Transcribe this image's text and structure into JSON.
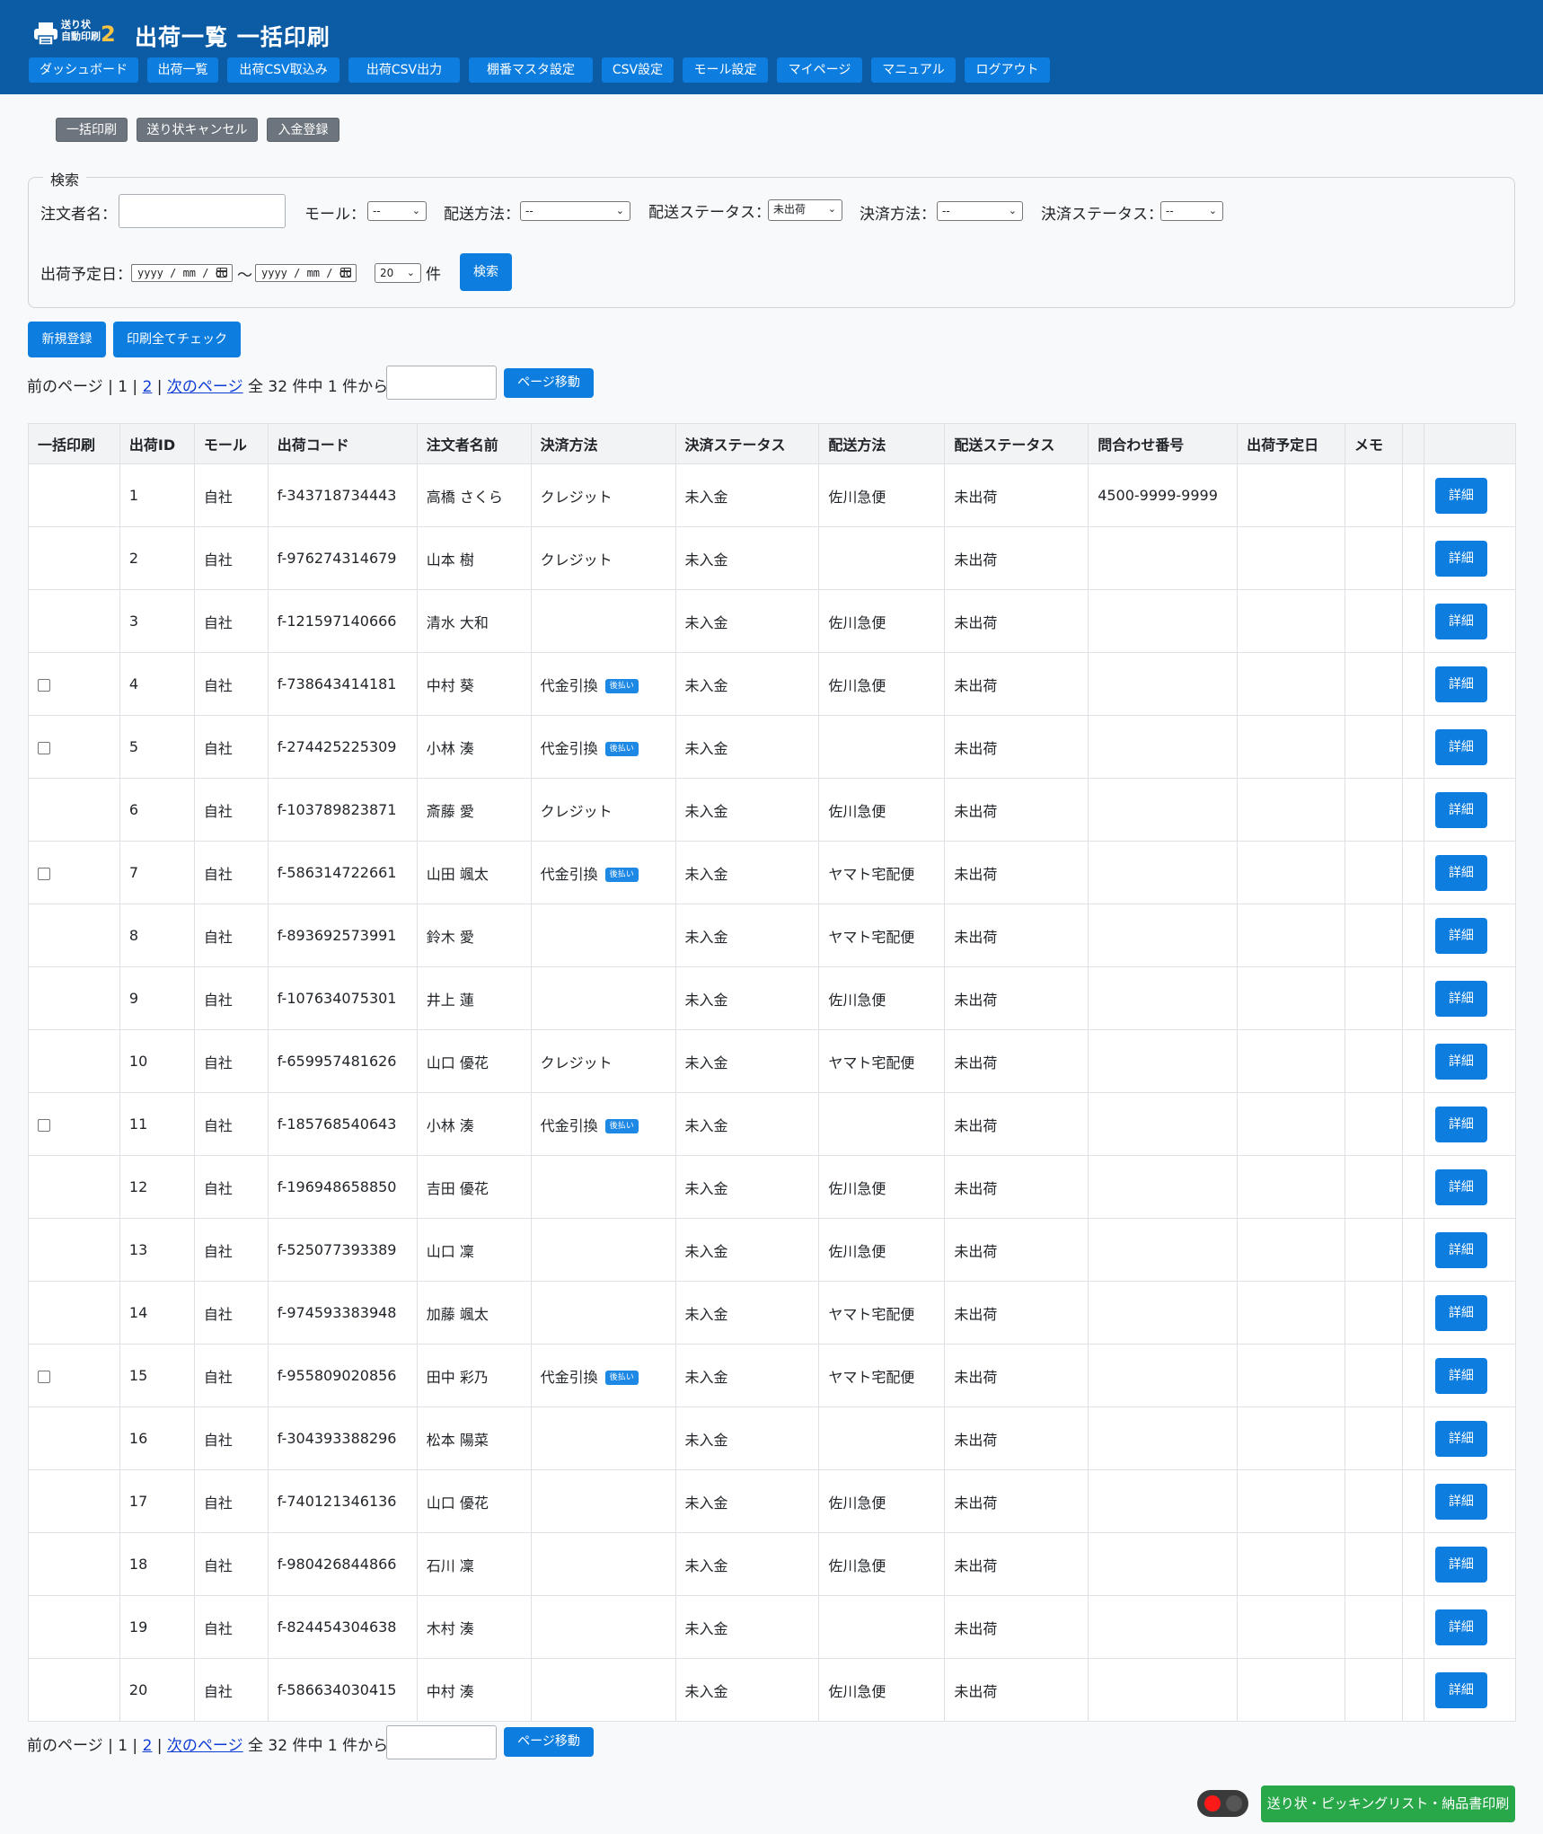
{
  "header": {
    "logo_line1": "送り状",
    "logo_line2": "自動印刷",
    "logo_num": "2",
    "title": "出荷一覧 一括印刷"
  },
  "nav": [
    "ダッシュボード",
    "出荷一覧",
    "出荷CSV取込み",
    "出荷CSV出力",
    "棚番マスタ設定",
    "CSV設定",
    "モール設定",
    "マイページ",
    "マニュアル",
    "ログアウト"
  ],
  "actions": [
    "一括印刷",
    "送り状キャンセル",
    "入金登録"
  ],
  "search": {
    "legend": "検索",
    "orderer_label": "注文者名：",
    "orderer_value": "",
    "mall_label": "モール：",
    "mall_value": "--",
    "ship_method_label": "配送方法：",
    "ship_method_value": "--",
    "ship_status_label": "配送ステータス：",
    "ship_status_value": "未出荷",
    "pay_method_label": "決済方法：",
    "pay_method_value": "--",
    "pay_status_label": "決済ステータス：",
    "pay_status_value": "--",
    "date_label": "出荷予定日：",
    "date_from": "yyyy / mm / dd",
    "date_sep": "〜",
    "date_to": "yyyy / mm / dd",
    "per_page": "20",
    "per_page_unit": "件",
    "search_button": "検索"
  },
  "buttons": {
    "new": "新規登録",
    "check_all": "印刷全てチェック",
    "page_move": "ページ移動",
    "detail": "詳細",
    "bottom_print": "送り状・ピッキングリスト・納品書印刷"
  },
  "pager": {
    "prev": "前のページ",
    "sep1": " | 1 | ",
    "page2": "2",
    "sep2": " | ",
    "next": "次のページ",
    "summary": " 全 32 件中 1 件から表示"
  },
  "table": {
    "headers": [
      "一括印刷",
      "出荷ID",
      "モール",
      "出荷コード",
      "注文者名前",
      "決済方法",
      "決済ステータス",
      "配送方法",
      "配送ステータス",
      "問合わせ番号",
      "出荷予定日",
      "メモ",
      "",
      ""
    ],
    "badge": "後払い",
    "rows": [
      {
        "check": false,
        "id": "1",
        "mall": "自社",
        "code": "f-343718734443",
        "name": "高橋 さくら",
        "pay": "クレジット",
        "badge": false,
        "pay_status": "未入金",
        "ship": "佐川急便",
        "ship_status": "未出荷",
        "tracking": "4500-9999-9999"
      },
      {
        "check": false,
        "id": "2",
        "mall": "自社",
        "code": "f-976274314679",
        "name": "山本 樹",
        "pay": "クレジット",
        "badge": false,
        "pay_status": "未入金",
        "ship": "",
        "ship_status": "未出荷",
        "tracking": ""
      },
      {
        "check": false,
        "id": "3",
        "mall": "自社",
        "code": "f-121597140666",
        "name": "清水 大和",
        "pay": "",
        "badge": false,
        "pay_status": "未入金",
        "ship": "佐川急便",
        "ship_status": "未出荷",
        "tracking": ""
      },
      {
        "check": true,
        "id": "4",
        "mall": "自社",
        "code": "f-738643414181",
        "name": "中村 葵",
        "pay": "代金引換",
        "badge": true,
        "pay_status": "未入金",
        "ship": "佐川急便",
        "ship_status": "未出荷",
        "tracking": ""
      },
      {
        "check": true,
        "id": "5",
        "mall": "自社",
        "code": "f-274425225309",
        "name": "小林 湊",
        "pay": "代金引換",
        "badge": true,
        "pay_status": "未入金",
        "ship": "",
        "ship_status": "未出荷",
        "tracking": ""
      },
      {
        "check": false,
        "id": "6",
        "mall": "自社",
        "code": "f-103789823871",
        "name": "斎藤 愛",
        "pay": "クレジット",
        "badge": false,
        "pay_status": "未入金",
        "ship": "佐川急便",
        "ship_status": "未出荷",
        "tracking": ""
      },
      {
        "check": true,
        "id": "7",
        "mall": "自社",
        "code": "f-586314722661",
        "name": "山田 颯太",
        "pay": "代金引換",
        "badge": true,
        "pay_status": "未入金",
        "ship": "ヤマト宅配便",
        "ship_status": "未出荷",
        "tracking": ""
      },
      {
        "check": false,
        "id": "8",
        "mall": "自社",
        "code": "f-893692573991",
        "name": "鈴木 愛",
        "pay": "",
        "badge": false,
        "pay_status": "未入金",
        "ship": "ヤマト宅配便",
        "ship_status": "未出荷",
        "tracking": ""
      },
      {
        "check": false,
        "id": "9",
        "mall": "自社",
        "code": "f-107634075301",
        "name": "井上 蓮",
        "pay": "",
        "badge": false,
        "pay_status": "未入金",
        "ship": "佐川急便",
        "ship_status": "未出荷",
        "tracking": ""
      },
      {
        "check": false,
        "id": "10",
        "mall": "自社",
        "code": "f-659957481626",
        "name": "山口 優花",
        "pay": "クレジット",
        "badge": false,
        "pay_status": "未入金",
        "ship": "ヤマト宅配便",
        "ship_status": "未出荷",
        "tracking": ""
      },
      {
        "check": true,
        "id": "11",
        "mall": "自社",
        "code": "f-185768540643",
        "name": "小林 湊",
        "pay": "代金引換",
        "badge": true,
        "pay_status": "未入金",
        "ship": "",
        "ship_status": "未出荷",
        "tracking": ""
      },
      {
        "check": false,
        "id": "12",
        "mall": "自社",
        "code": "f-196948658850",
        "name": "吉田 優花",
        "pay": "",
        "badge": false,
        "pay_status": "未入金",
        "ship": "佐川急便",
        "ship_status": "未出荷",
        "tracking": ""
      },
      {
        "check": false,
        "id": "13",
        "mall": "自社",
        "code": "f-525077393389",
        "name": "山口 凜",
        "pay": "",
        "badge": false,
        "pay_status": "未入金",
        "ship": "佐川急便",
        "ship_status": "未出荷",
        "tracking": ""
      },
      {
        "check": false,
        "id": "14",
        "mall": "自社",
        "code": "f-974593383948",
        "name": "加藤 颯太",
        "pay": "",
        "badge": false,
        "pay_status": "未入金",
        "ship": "ヤマト宅配便",
        "ship_status": "未出荷",
        "tracking": ""
      },
      {
        "check": true,
        "id": "15",
        "mall": "自社",
        "code": "f-955809020856",
        "name": "田中 彩乃",
        "pay": "代金引換",
        "badge": true,
        "pay_status": "未入金",
        "ship": "ヤマト宅配便",
        "ship_status": "未出荷",
        "tracking": ""
      },
      {
        "check": false,
        "id": "16",
        "mall": "自社",
        "code": "f-304393388296",
        "name": "松本 陽菜",
        "pay": "",
        "badge": false,
        "pay_status": "未入金",
        "ship": "",
        "ship_status": "未出荷",
        "tracking": ""
      },
      {
        "check": false,
        "id": "17",
        "mall": "自社",
        "code": "f-740121346136",
        "name": "山口 優花",
        "pay": "",
        "badge": false,
        "pay_status": "未入金",
        "ship": "佐川急便",
        "ship_status": "未出荷",
        "tracking": ""
      },
      {
        "check": false,
        "id": "18",
        "mall": "自社",
        "code": "f-980426844866",
        "name": "石川 凜",
        "pay": "",
        "badge": false,
        "pay_status": "未入金",
        "ship": "佐川急便",
        "ship_status": "未出荷",
        "tracking": ""
      },
      {
        "check": false,
        "id": "19",
        "mall": "自社",
        "code": "f-824454304638",
        "name": "木村 湊",
        "pay": "",
        "badge": false,
        "pay_status": "未入金",
        "ship": "",
        "ship_status": "未出荷",
        "tracking": ""
      },
      {
        "check": false,
        "id": "20",
        "mall": "自社",
        "code": "f-586634030415",
        "name": "中村 湊",
        "pay": "",
        "badge": false,
        "pay_status": "未入金",
        "ship": "佐川急便",
        "ship_status": "未出荷",
        "tracking": ""
      }
    ]
  },
  "colors": {
    "header_bg": "#0b5ba5",
    "primary": "#0d7ee0",
    "secondary": "#6c757d",
    "success": "#29a84a",
    "logo_accent": "#f6c344"
  }
}
